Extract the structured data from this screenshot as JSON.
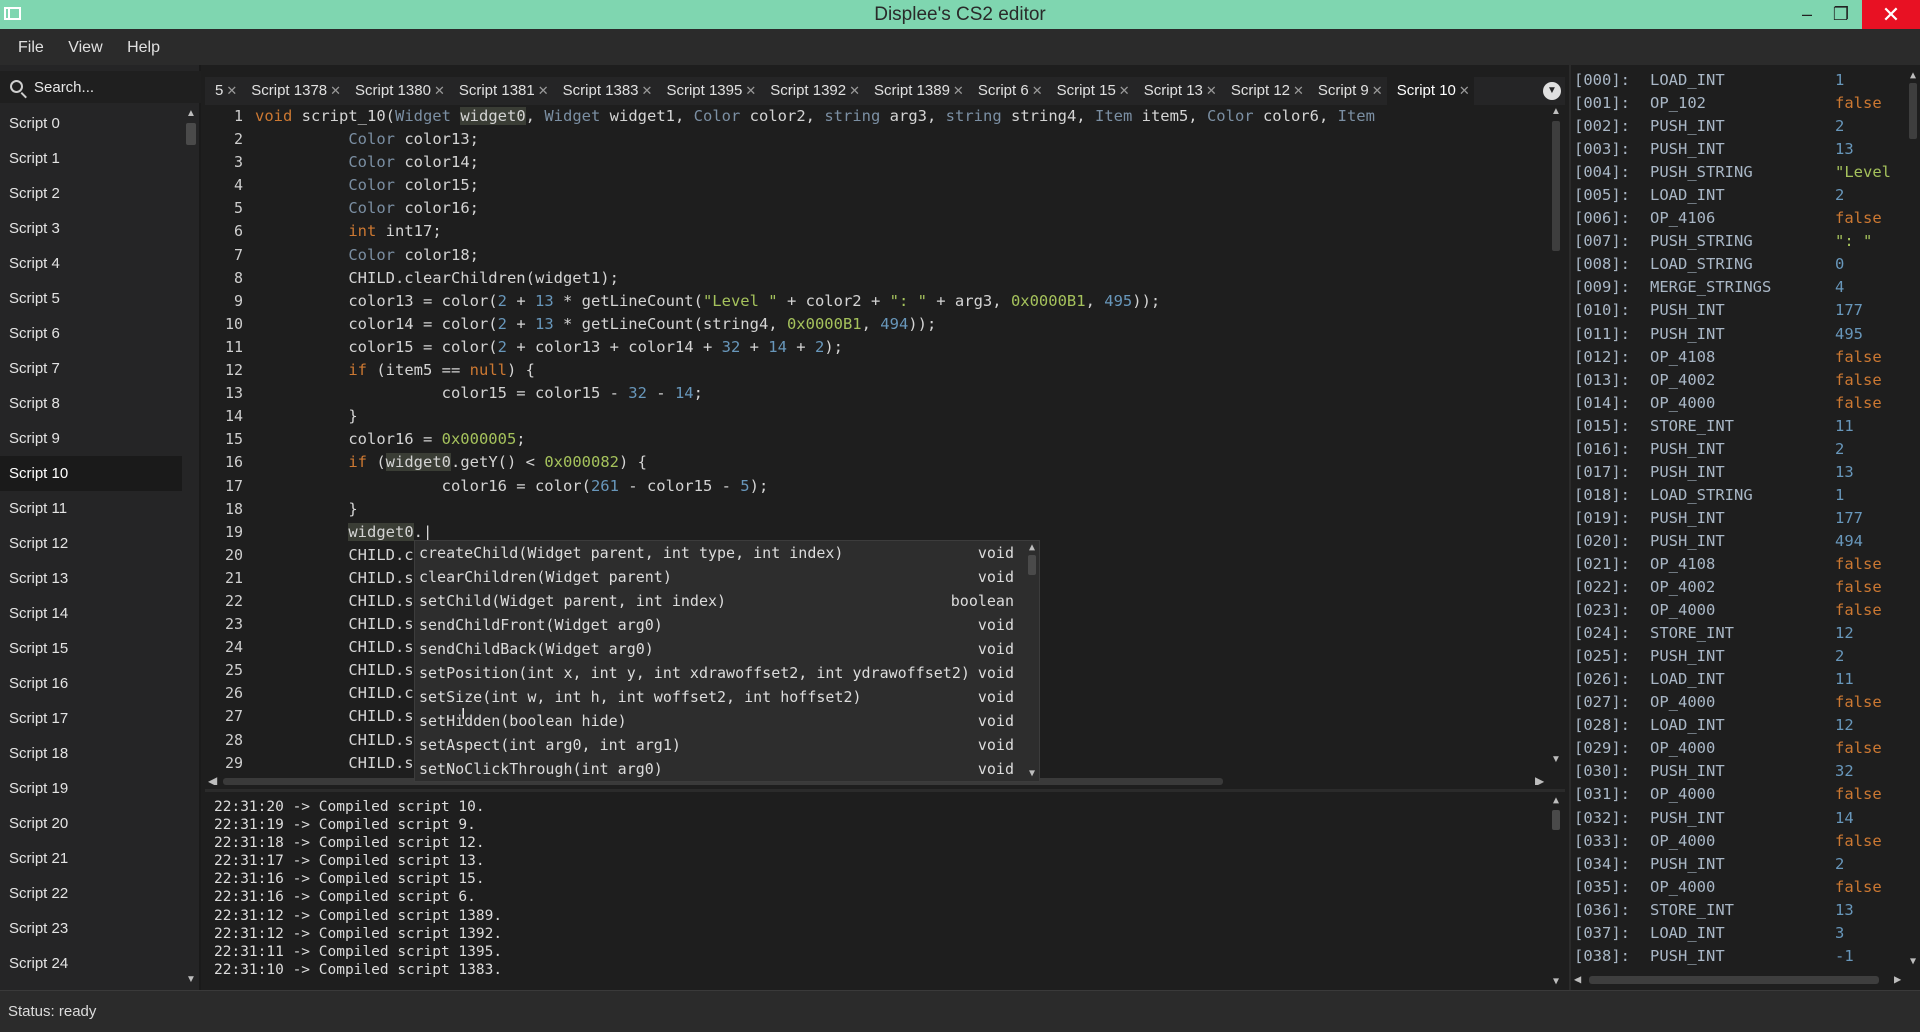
{
  "window": {
    "title": "Displee's CS2 editor",
    "minimize": "–",
    "maximize": "❐",
    "close": "✕"
  },
  "menu": [
    "File",
    "View",
    "Help"
  ],
  "search": {
    "placeholder": "Search..."
  },
  "scripts": [
    "Script 0",
    "Script 1",
    "Script 2",
    "Script 3",
    "Script 4",
    "Script 5",
    "Script 6",
    "Script 7",
    "Script 8",
    "Script 9",
    "Script 10",
    "Script 11",
    "Script 12",
    "Script 13",
    "Script 14",
    "Script 15",
    "Script 16",
    "Script 17",
    "Script 18",
    "Script 19",
    "Script 20",
    "Script 21",
    "Script 22",
    "Script 23",
    "Script 24"
  ],
  "active_script": "Script 10",
  "tabs": [
    "5",
    "Script 1378",
    "Script 1380",
    "Script 1381",
    "Script 1383",
    "Script 1395",
    "Script 1392",
    "Script 1389",
    "Script 6",
    "Script 15",
    "Script 13",
    "Script 12",
    "Script 9",
    "Script 10"
  ],
  "active_tab": "Script 10",
  "code_lines": [
    [
      [
        "kw",
        "void"
      ],
      [
        "fn",
        " script_10("
      ],
      [
        "ty",
        "Widget"
      ],
      [
        "fn",
        " "
      ],
      [
        "hl",
        "widget0"
      ],
      [
        "fn",
        ", "
      ],
      [
        "ty",
        "Widget"
      ],
      [
        "fn",
        " widget1, "
      ],
      [
        "ty",
        "Color"
      ],
      [
        "fn",
        " color2, "
      ],
      [
        "ty",
        "string"
      ],
      [
        "fn",
        " arg3, "
      ],
      [
        "ty",
        "string"
      ],
      [
        "fn",
        " string4, "
      ],
      [
        "ty",
        "Item"
      ],
      [
        "fn",
        " item5, "
      ],
      [
        "ty",
        "Color"
      ],
      [
        "fn",
        " color6, "
      ],
      [
        "ty",
        "Item"
      ]
    ],
    [
      [
        "fn",
        "          "
      ],
      [
        "ty",
        "Color"
      ],
      [
        "fn",
        " color13;"
      ]
    ],
    [
      [
        "fn",
        "          "
      ],
      [
        "ty",
        "Color"
      ],
      [
        "fn",
        " color14;"
      ]
    ],
    [
      [
        "fn",
        "          "
      ],
      [
        "ty",
        "Color"
      ],
      [
        "fn",
        " color15;"
      ]
    ],
    [
      [
        "fn",
        "          "
      ],
      [
        "ty",
        "Color"
      ],
      [
        "fn",
        " color16;"
      ]
    ],
    [
      [
        "fn",
        "          "
      ],
      [
        "kw",
        "int"
      ],
      [
        "fn",
        " int17;"
      ]
    ],
    [
      [
        "fn",
        "          "
      ],
      [
        "ty",
        "Color"
      ],
      [
        "fn",
        " color18;"
      ]
    ],
    [
      [
        "fn",
        "          CHILD.clearChildren(widget1);"
      ]
    ],
    [
      [
        "fn",
        "          color13 = color("
      ],
      [
        "num",
        "2"
      ],
      [
        "fn",
        " + "
      ],
      [
        "num",
        "13"
      ],
      [
        "fn",
        " * getLineCount("
      ],
      [
        "str",
        "\"Level \""
      ],
      [
        "fn",
        " + color2 + "
      ],
      [
        "str",
        "\": \""
      ],
      [
        "fn",
        " + arg3, "
      ],
      [
        "hex",
        "0x0000B1"
      ],
      [
        "fn",
        ", "
      ],
      [
        "num",
        "495"
      ],
      [
        "fn",
        "));"
      ]
    ],
    [
      [
        "fn",
        "          color14 = color("
      ],
      [
        "num",
        "2"
      ],
      [
        "fn",
        " + "
      ],
      [
        "num",
        "13"
      ],
      [
        "fn",
        " * getLineCount(string4, "
      ],
      [
        "hex",
        "0x0000B1"
      ],
      [
        "fn",
        ", "
      ],
      [
        "num",
        "494"
      ],
      [
        "fn",
        "));"
      ]
    ],
    [
      [
        "fn",
        "          color15 = color("
      ],
      [
        "num",
        "2"
      ],
      [
        "fn",
        " + color13 + color14 + "
      ],
      [
        "num",
        "32"
      ],
      [
        "fn",
        " + "
      ],
      [
        "num",
        "14"
      ],
      [
        "fn",
        " + "
      ],
      [
        "num",
        "2"
      ],
      [
        "fn",
        ");"
      ]
    ],
    [
      [
        "fn",
        "          "
      ],
      [
        "kw",
        "if"
      ],
      [
        "fn",
        " (item5 == "
      ],
      [
        "kw",
        "null"
      ],
      [
        "fn",
        ") {"
      ]
    ],
    [
      [
        "fn",
        "                    color15 = color15 - "
      ],
      [
        "num",
        "32"
      ],
      [
        "fn",
        " - "
      ],
      [
        "num",
        "14"
      ],
      [
        "fn",
        ";"
      ]
    ],
    [
      [
        "fn",
        "          }"
      ]
    ],
    [
      [
        "fn",
        "          color16 = "
      ],
      [
        "hex",
        "0x000005"
      ],
      [
        "fn",
        ";"
      ]
    ],
    [
      [
        "fn",
        "          "
      ],
      [
        "kw",
        "if"
      ],
      [
        "fn",
        " ("
      ],
      [
        "hl",
        "widget0"
      ],
      [
        "fn",
        ".getY() < "
      ],
      [
        "hex",
        "0x000082"
      ],
      [
        "fn",
        ") {"
      ]
    ],
    [
      [
        "fn",
        "                    color16 = color("
      ],
      [
        "num",
        "261"
      ],
      [
        "fn",
        " - color15 - "
      ],
      [
        "num",
        "5"
      ],
      [
        "fn",
        ");"
      ]
    ],
    [
      [
        "fn",
        "          }"
      ]
    ],
    [
      [
        "fn",
        "          "
      ],
      [
        "hl",
        "widget0"
      ],
      [
        "fn",
        ".|"
      ]
    ],
    [
      [
        "fn",
        "          CHILD.c"
      ]
    ],
    [
      [
        "fn",
        "          CHILD.s"
      ]
    ],
    [
      [
        "fn",
        "          CHILD.s"
      ]
    ],
    [
      [
        "fn",
        "          CHILD.s"
      ]
    ],
    [
      [
        "fn",
        "          CHILD.s"
      ]
    ],
    [
      [
        "fn",
        "          CHILD.s"
      ]
    ],
    [
      [
        "fn",
        "          CHILD.c"
      ]
    ],
    [
      [
        "fn",
        "          CHILD.s"
      ]
    ],
    [
      [
        "fn",
        "          CHILD.s"
      ]
    ],
    [
      [
        "fn",
        "          CHILD.s"
      ]
    ]
  ],
  "autocomplete": [
    {
      "sig": "createChild(Widget parent, int type, int index)",
      "ret": "void"
    },
    {
      "sig": "clearChildren(Widget parent)",
      "ret": "void"
    },
    {
      "sig": "setChild(Widget parent, int index)",
      "ret": "boolean"
    },
    {
      "sig": "sendChildFront(Widget arg0)",
      "ret": "void"
    },
    {
      "sig": "sendChildBack(Widget arg0)",
      "ret": "void"
    },
    {
      "sig": "setPosition(int x, int y, int xdrawoffset2, int ydrawoffset2)",
      "ret": "void"
    },
    {
      "sig": "setSize(int w, int h, int woffset2, int hoffset2)",
      "ret": "void"
    },
    {
      "sig": "setHidden(boolean hide)",
      "ret": "void"
    },
    {
      "sig": "setAspect(int arg0, int arg1)",
      "ret": "void"
    },
    {
      "sig": "setNoClickThrough(int arg0)",
      "ret": "void"
    }
  ],
  "log": [
    "22:31:20 -> Compiled script 10.",
    "22:31:19 -> Compiled script 9.",
    "22:31:18 -> Compiled script 12.",
    "22:31:17 -> Compiled script 13.",
    "22:31:16 -> Compiled script 15.",
    "22:31:16 -> Compiled script 6.",
    "22:31:12 -> Compiled script 1389.",
    "22:31:12 -> Compiled script 1392.",
    "22:31:11 -> Compiled script 1395.",
    "22:31:10 -> Compiled script 1383."
  ],
  "bytecode": [
    [
      "[000]:",
      "LOAD_INT",
      "1"
    ],
    [
      "[001]:",
      "OP_102",
      "false"
    ],
    [
      "[002]:",
      "PUSH_INT",
      "2"
    ],
    [
      "[003]:",
      "PUSH_INT",
      "13"
    ],
    [
      "[004]:",
      "PUSH_STRING",
      "\"Level"
    ],
    [
      "[005]:",
      "LOAD_INT",
      "2"
    ],
    [
      "[006]:",
      "OP_4106",
      "false"
    ],
    [
      "[007]:",
      "PUSH_STRING",
      "\": \""
    ],
    [
      "[008]:",
      "LOAD_STRING",
      "0"
    ],
    [
      "[009]:",
      "MERGE_STRINGS",
      "4"
    ],
    [
      "[010]:",
      "PUSH_INT",
      "177"
    ],
    [
      "[011]:",
      "PUSH_INT",
      "495"
    ],
    [
      "[012]:",
      "OP_4108",
      "false"
    ],
    [
      "[013]:",
      "OP_4002",
      "false"
    ],
    [
      "[014]:",
      "OP_4000",
      "false"
    ],
    [
      "[015]:",
      "STORE_INT",
      "11"
    ],
    [
      "[016]:",
      "PUSH_INT",
      "2"
    ],
    [
      "[017]:",
      "PUSH_INT",
      "13"
    ],
    [
      "[018]:",
      "LOAD_STRING",
      "1"
    ],
    [
      "[019]:",
      "PUSH_INT",
      "177"
    ],
    [
      "[020]:",
      "PUSH_INT",
      "494"
    ],
    [
      "[021]:",
      "OP_4108",
      "false"
    ],
    [
      "[022]:",
      "OP_4002",
      "false"
    ],
    [
      "[023]:",
      "OP_4000",
      "false"
    ],
    [
      "[024]:",
      "STORE_INT",
      "12"
    ],
    [
      "[025]:",
      "PUSH_INT",
      "2"
    ],
    [
      "[026]:",
      "LOAD_INT",
      "11"
    ],
    [
      "[027]:",
      "OP_4000",
      "false"
    ],
    [
      "[028]:",
      "LOAD_INT",
      "12"
    ],
    [
      "[029]:",
      "OP_4000",
      "false"
    ],
    [
      "[030]:",
      "PUSH_INT",
      "32"
    ],
    [
      "[031]:",
      "OP_4000",
      "false"
    ],
    [
      "[032]:",
      "PUSH_INT",
      "14"
    ],
    [
      "[033]:",
      "OP_4000",
      "false"
    ],
    [
      "[034]:",
      "PUSH_INT",
      "2"
    ],
    [
      "[035]:",
      "OP_4000",
      "false"
    ],
    [
      "[036]:",
      "STORE_INT",
      "13"
    ],
    [
      "[037]:",
      "LOAD_INT",
      "3"
    ],
    [
      "[038]:",
      "PUSH_INT",
      "-1"
    ]
  ],
  "status": "Status: ready",
  "icons": {
    "app": "app-window-icon",
    "search": "search-icon",
    "tab_close": "close-icon",
    "tab_menu": "chevron-down-icon"
  }
}
